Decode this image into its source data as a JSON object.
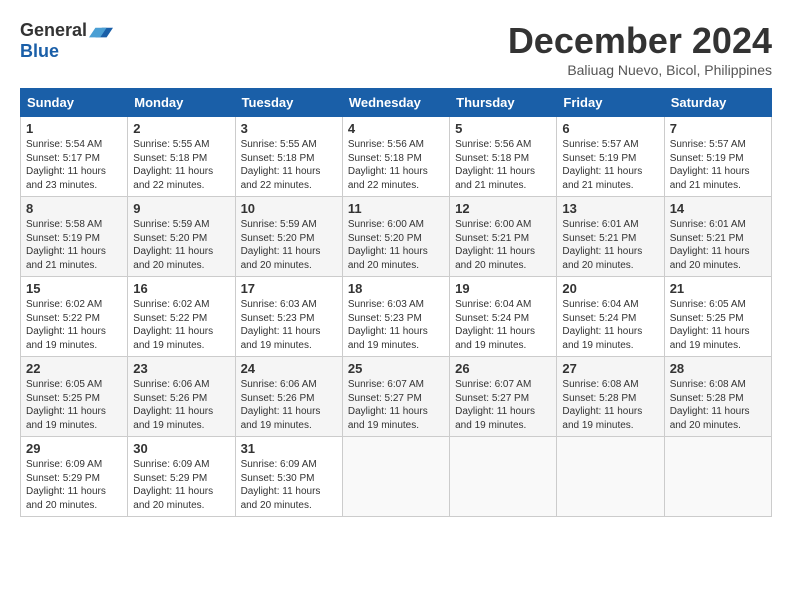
{
  "logo": {
    "general": "General",
    "blue": "Blue"
  },
  "title": "December 2024",
  "location": "Baliuag Nuevo, Bicol, Philippines",
  "days_of_week": [
    "Sunday",
    "Monday",
    "Tuesday",
    "Wednesday",
    "Thursday",
    "Friday",
    "Saturday"
  ],
  "weeks": [
    [
      {
        "day": "1",
        "info": "Sunrise: 5:54 AM\nSunset: 5:17 PM\nDaylight: 11 hours\nand 23 minutes."
      },
      {
        "day": "2",
        "info": "Sunrise: 5:55 AM\nSunset: 5:18 PM\nDaylight: 11 hours\nand 22 minutes."
      },
      {
        "day": "3",
        "info": "Sunrise: 5:55 AM\nSunset: 5:18 PM\nDaylight: 11 hours\nand 22 minutes."
      },
      {
        "day": "4",
        "info": "Sunrise: 5:56 AM\nSunset: 5:18 PM\nDaylight: 11 hours\nand 22 minutes."
      },
      {
        "day": "5",
        "info": "Sunrise: 5:56 AM\nSunset: 5:18 PM\nDaylight: 11 hours\nand 21 minutes."
      },
      {
        "day": "6",
        "info": "Sunrise: 5:57 AM\nSunset: 5:19 PM\nDaylight: 11 hours\nand 21 minutes."
      },
      {
        "day": "7",
        "info": "Sunrise: 5:57 AM\nSunset: 5:19 PM\nDaylight: 11 hours\nand 21 minutes."
      }
    ],
    [
      {
        "day": "8",
        "info": "Sunrise: 5:58 AM\nSunset: 5:19 PM\nDaylight: 11 hours\nand 21 minutes."
      },
      {
        "day": "9",
        "info": "Sunrise: 5:59 AM\nSunset: 5:20 PM\nDaylight: 11 hours\nand 20 minutes."
      },
      {
        "day": "10",
        "info": "Sunrise: 5:59 AM\nSunset: 5:20 PM\nDaylight: 11 hours\nand 20 minutes."
      },
      {
        "day": "11",
        "info": "Sunrise: 6:00 AM\nSunset: 5:20 PM\nDaylight: 11 hours\nand 20 minutes."
      },
      {
        "day": "12",
        "info": "Sunrise: 6:00 AM\nSunset: 5:21 PM\nDaylight: 11 hours\nand 20 minutes."
      },
      {
        "day": "13",
        "info": "Sunrise: 6:01 AM\nSunset: 5:21 PM\nDaylight: 11 hours\nand 20 minutes."
      },
      {
        "day": "14",
        "info": "Sunrise: 6:01 AM\nSunset: 5:21 PM\nDaylight: 11 hours\nand 20 minutes."
      }
    ],
    [
      {
        "day": "15",
        "info": "Sunrise: 6:02 AM\nSunset: 5:22 PM\nDaylight: 11 hours\nand 19 minutes."
      },
      {
        "day": "16",
        "info": "Sunrise: 6:02 AM\nSunset: 5:22 PM\nDaylight: 11 hours\nand 19 minutes."
      },
      {
        "day": "17",
        "info": "Sunrise: 6:03 AM\nSunset: 5:23 PM\nDaylight: 11 hours\nand 19 minutes."
      },
      {
        "day": "18",
        "info": "Sunrise: 6:03 AM\nSunset: 5:23 PM\nDaylight: 11 hours\nand 19 minutes."
      },
      {
        "day": "19",
        "info": "Sunrise: 6:04 AM\nSunset: 5:24 PM\nDaylight: 11 hours\nand 19 minutes."
      },
      {
        "day": "20",
        "info": "Sunrise: 6:04 AM\nSunset: 5:24 PM\nDaylight: 11 hours\nand 19 minutes."
      },
      {
        "day": "21",
        "info": "Sunrise: 6:05 AM\nSunset: 5:25 PM\nDaylight: 11 hours\nand 19 minutes."
      }
    ],
    [
      {
        "day": "22",
        "info": "Sunrise: 6:05 AM\nSunset: 5:25 PM\nDaylight: 11 hours\nand 19 minutes."
      },
      {
        "day": "23",
        "info": "Sunrise: 6:06 AM\nSunset: 5:26 PM\nDaylight: 11 hours\nand 19 minutes."
      },
      {
        "day": "24",
        "info": "Sunrise: 6:06 AM\nSunset: 5:26 PM\nDaylight: 11 hours\nand 19 minutes."
      },
      {
        "day": "25",
        "info": "Sunrise: 6:07 AM\nSunset: 5:27 PM\nDaylight: 11 hours\nand 19 minutes."
      },
      {
        "day": "26",
        "info": "Sunrise: 6:07 AM\nSunset: 5:27 PM\nDaylight: 11 hours\nand 19 minutes."
      },
      {
        "day": "27",
        "info": "Sunrise: 6:08 AM\nSunset: 5:28 PM\nDaylight: 11 hours\nand 19 minutes."
      },
      {
        "day": "28",
        "info": "Sunrise: 6:08 AM\nSunset: 5:28 PM\nDaylight: 11 hours\nand 20 minutes."
      }
    ],
    [
      {
        "day": "29",
        "info": "Sunrise: 6:09 AM\nSunset: 5:29 PM\nDaylight: 11 hours\nand 20 minutes."
      },
      {
        "day": "30",
        "info": "Sunrise: 6:09 AM\nSunset: 5:29 PM\nDaylight: 11 hours\nand 20 minutes."
      },
      {
        "day": "31",
        "info": "Sunrise: 6:09 AM\nSunset: 5:30 PM\nDaylight: 11 hours\nand 20 minutes."
      },
      {
        "day": "",
        "info": ""
      },
      {
        "day": "",
        "info": ""
      },
      {
        "day": "",
        "info": ""
      },
      {
        "day": "",
        "info": ""
      }
    ]
  ]
}
